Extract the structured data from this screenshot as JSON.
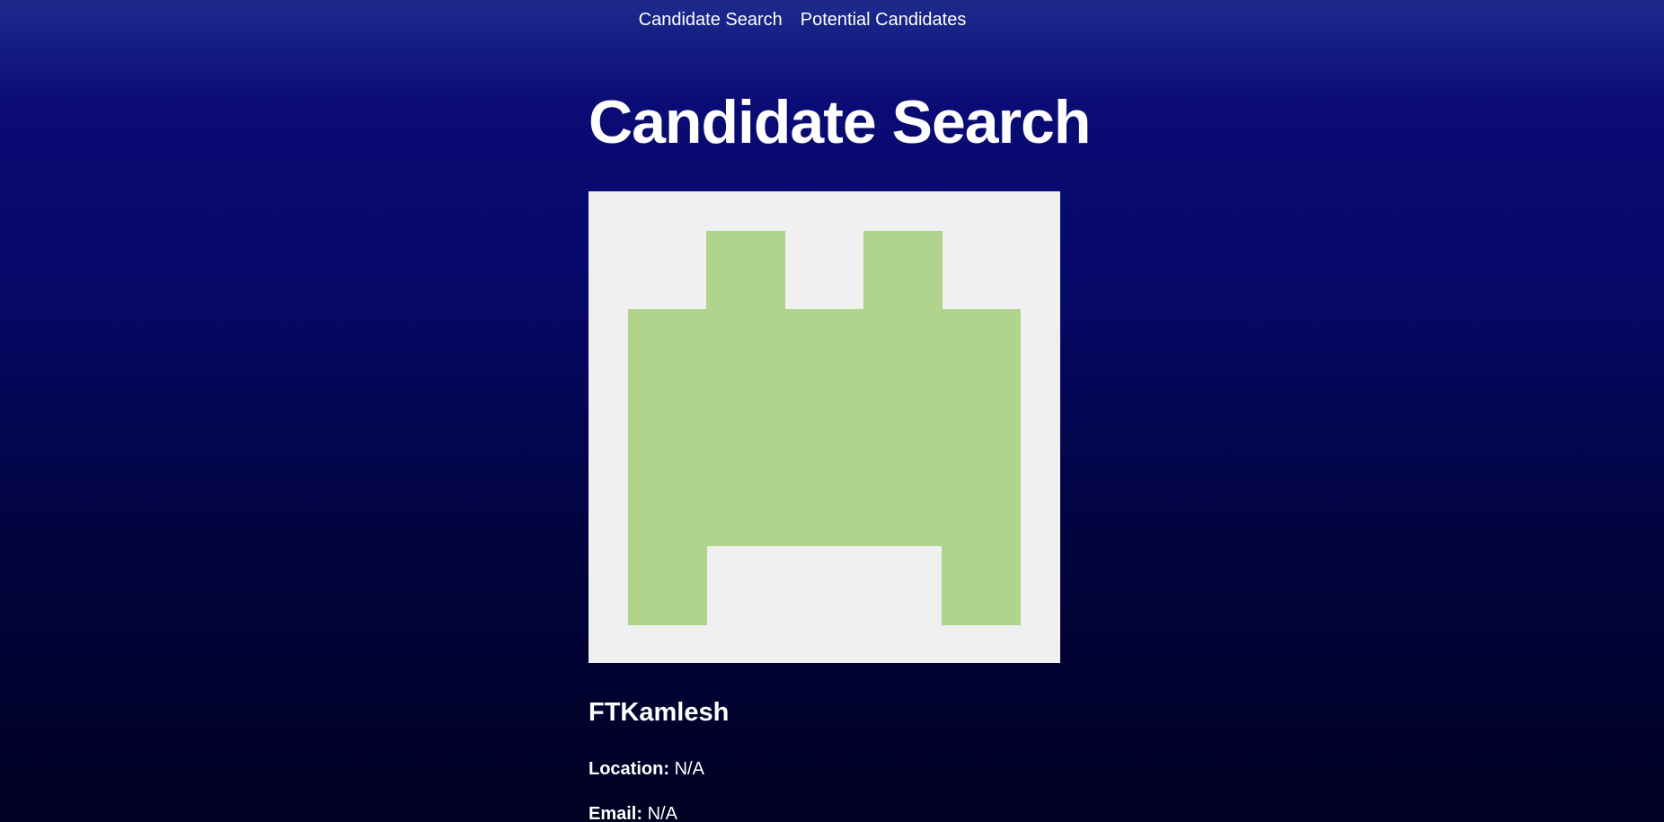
{
  "nav": {
    "items": [
      {
        "label": "Candidate Search"
      },
      {
        "label": "Potential Candidates"
      }
    ]
  },
  "page": {
    "title": "Candidate Search"
  },
  "candidate": {
    "avatar_icon": "identicon-avatar",
    "avatar_colors": {
      "background": "#f0f0f0",
      "foreground": "#b0d48c"
    },
    "username": "FTKamlesh",
    "location_label": "Location:",
    "location_value": "N/A",
    "email_label": "Email:",
    "email_value": "N/A"
  }
}
